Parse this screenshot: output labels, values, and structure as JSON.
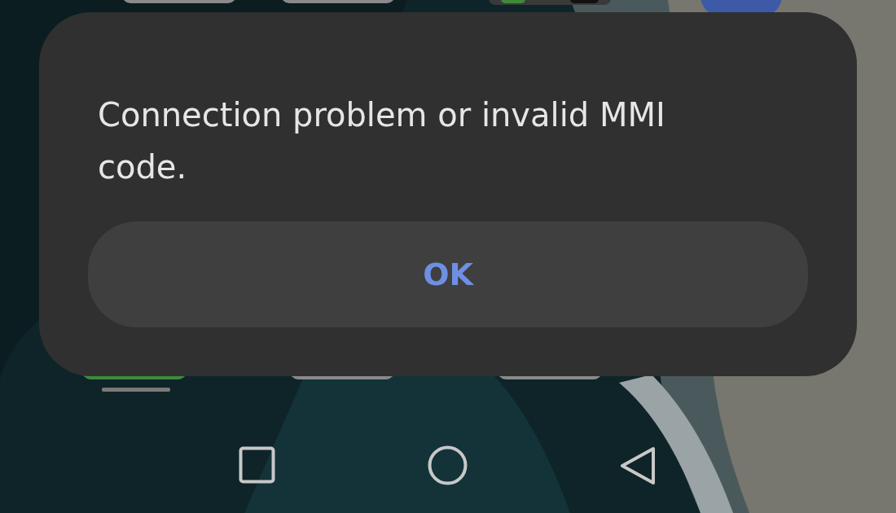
{
  "dialog": {
    "message": "Connection problem or invalid MMI code.",
    "button": {
      "label": "OK"
    }
  }
}
